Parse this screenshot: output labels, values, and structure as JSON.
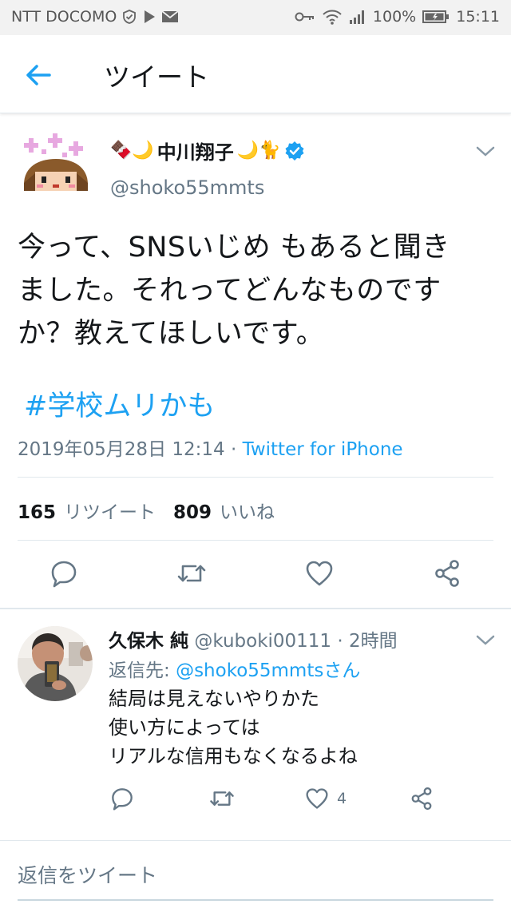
{
  "status_bar": {
    "carrier": "NTT DOCOMO",
    "battery": "100%",
    "time": "15:11"
  },
  "header": {
    "title": "ツイート"
  },
  "tweet": {
    "display_name_prefix": "🍫🌙",
    "display_name": "中川翔子",
    "display_name_suffix": "🌙🐈",
    "handle": "@shoko55mmts",
    "text": "今って、SNSいじめ もあると聞き\nました。それってどんなものです\nか？教えてほしいです。",
    "hashtag": "#学校ムリかも",
    "timestamp": "2019年05月28日 12:14 · ",
    "source": "Twitter for iPhone",
    "retweet_count": "165",
    "retweet_label": "リツイート",
    "like_count": "809",
    "like_label": "いいね"
  },
  "reply": {
    "name": "久保木 純",
    "handle": "@kuboki00111",
    "time": " · 2時間",
    "reply_to_label": "返信先: ",
    "reply_to_mention": "@shoko55mmtsさん",
    "text": "結局は見えないやりかた\n使い方によっては\nリアルな信用もなくなるよね",
    "like_count": "4"
  },
  "compose": {
    "placeholder": "返信をツイート"
  },
  "colors": {
    "accent": "#1da1f2",
    "secondary_text": "#657786",
    "primary_text": "#14171a",
    "divider": "#e1e8ed"
  }
}
